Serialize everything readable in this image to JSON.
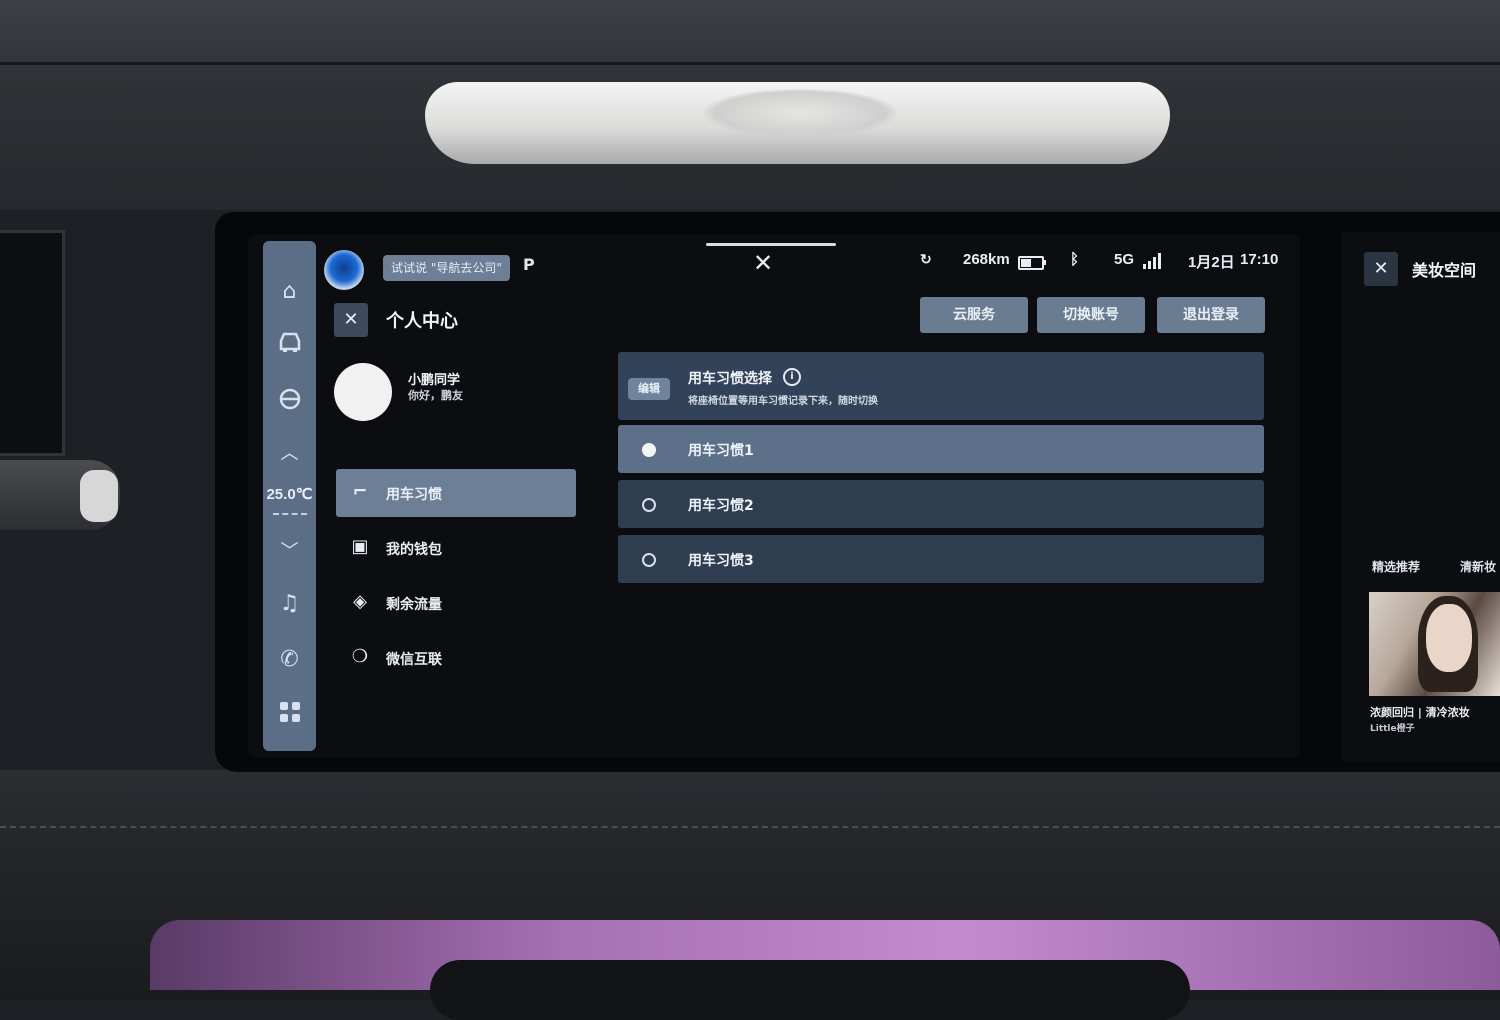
{
  "top_bar": {
    "voice_hint": "试试说 \"导航去公司\"",
    "range": "268km",
    "network": "5G",
    "date": "1月2日",
    "time": "17:10"
  },
  "side_rail": {
    "temperature": "25.0℃"
  },
  "page": {
    "title": "个人中心",
    "buttons": [
      "云服务",
      "切换账号",
      "退出登录"
    ]
  },
  "user": {
    "name": "小鹏同学",
    "greeting": "你好，鹏友"
  },
  "menu": {
    "items": [
      {
        "label": "用车习惯",
        "icon": "seat-icon",
        "active": true
      },
      {
        "label": "我的钱包",
        "icon": "wallet-icon",
        "active": false
      },
      {
        "label": "剩余流量",
        "icon": "data-icon",
        "active": false
      },
      {
        "label": "微信互联",
        "icon": "wechat-icon",
        "active": false
      }
    ]
  },
  "habits": {
    "edit_label": "编辑",
    "title": "用车习惯选择",
    "subtitle": "将座椅位置等用车习惯记录下来，随时切换",
    "options": [
      "用车习惯1",
      "用车习惯2",
      "用车习惯3"
    ],
    "selected_index": 0
  },
  "right_screen": {
    "title": "美妆空间",
    "tab1": "精选推荐",
    "tab2": "清新妆",
    "video_caption": "浓颜回归 | 清冷浓妆",
    "video_author": "Little橙子"
  },
  "colors": {
    "accent": "#6c7f96",
    "panel": "#2f3d51",
    "ambient_light": "#c38bd0"
  }
}
